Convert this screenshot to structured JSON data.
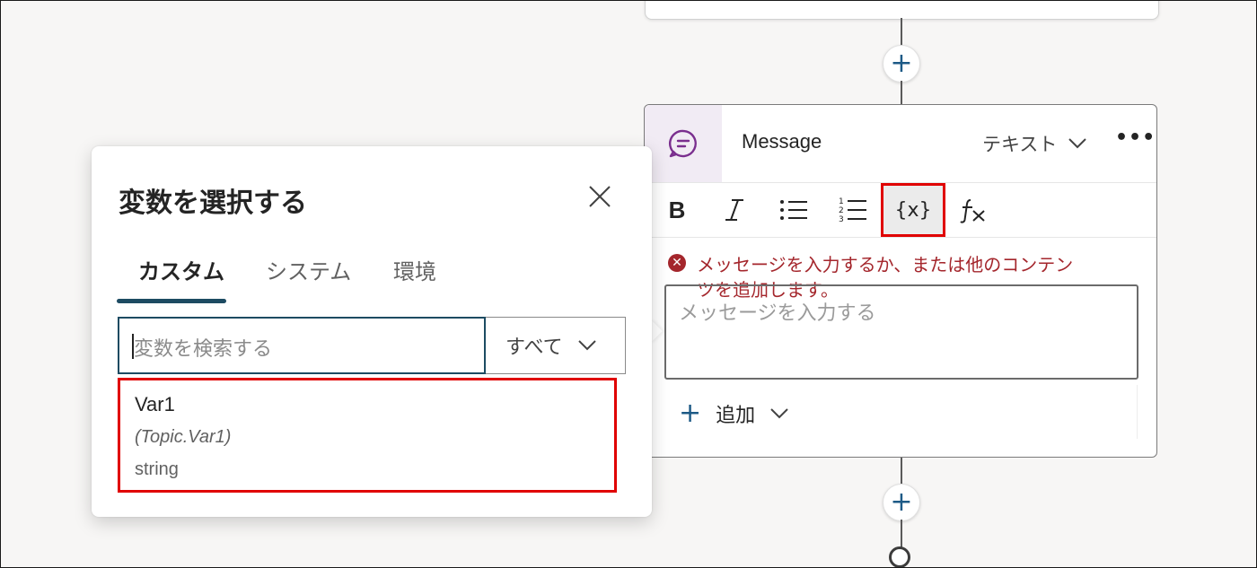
{
  "message_node": {
    "title": "Message",
    "type_label": "テキスト",
    "more_label": "•••",
    "toolbar": {
      "bold": "B",
      "variable": "{x}"
    },
    "error_text": "メッセージを入力するか、または他のコンテンツを追加します。",
    "input_placeholder": "メッセージを入力する",
    "add_label": "追加",
    "add_plus": "+"
  },
  "canvas": {
    "add_node_symbol": "+"
  },
  "variable_picker": {
    "title": "変数を選択する",
    "tabs": [
      {
        "label": "カスタム"
      },
      {
        "label": "システム"
      },
      {
        "label": "環境"
      }
    ],
    "search_placeholder": "変数を検索する",
    "filter_value": "すべて",
    "items": [
      {
        "name": "Var1",
        "path": "(Topic.Var1)",
        "type": "string"
      }
    ]
  },
  "colors": {
    "accent": "#1d4b62",
    "highlight_red": "#e00000",
    "error": "#a4262c",
    "node_icon_bg": "#f1ebf4",
    "node_icon": "#7a2e8e"
  },
  "icons": [
    "chat-bubble-icon",
    "chevron-down-icon",
    "more-icon",
    "bold-icon",
    "italic-icon",
    "bulleted-list-icon",
    "numbered-list-icon",
    "variable-icon",
    "formula-icon",
    "error-icon",
    "add-icon",
    "close-icon"
  ]
}
